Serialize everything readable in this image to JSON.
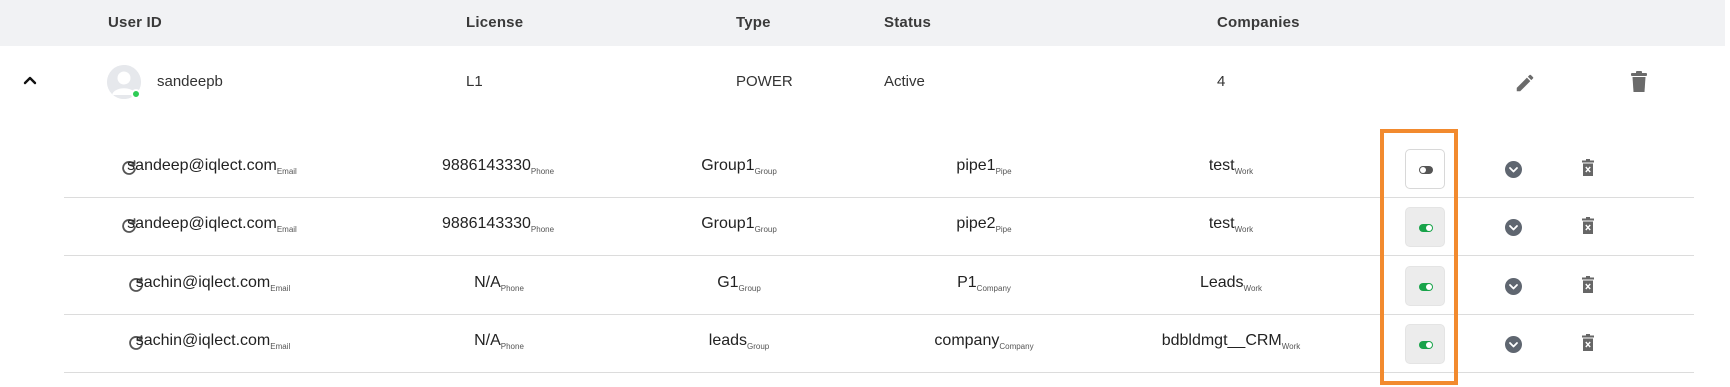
{
  "header": {
    "user_id": "User ID",
    "license": "License",
    "type": "Type",
    "status": "Status",
    "companies": "Companies"
  },
  "user": {
    "username": "sandeepb",
    "license": "L1",
    "type": "POWER",
    "status": "Active",
    "companies": "4",
    "expanded": true,
    "online": true
  },
  "icons": {
    "collapse": "chevron-up-icon",
    "edit": "pencil-icon",
    "delete": "trash-icon",
    "refresh": "refresh-icon",
    "toggle": "toggle-icon",
    "expand": "chevron-down-circle-icon",
    "remove": "trash-x-icon"
  },
  "colors": {
    "header_bg": "#f1f2f4",
    "toggle_on": "#18a34a",
    "online": "#2ecc55",
    "highlight": "#f28a2e"
  },
  "mappings": [
    {
      "email": "sandeep@iqlect.com",
      "email_tag": "Email",
      "phone": "9886143330",
      "phone_tag": "Phone",
      "group": "Group1",
      "group_tag": "Group",
      "target": "pipe1",
      "target_tag": "Pipe",
      "work": "test",
      "work_tag": "Work",
      "enabled": false
    },
    {
      "email": "sandeep@iqlect.com",
      "email_tag": "Email",
      "phone": "9886143330",
      "phone_tag": "Phone",
      "group": "Group1",
      "group_tag": "Group",
      "target": "pipe2",
      "target_tag": "Pipe",
      "work": "test",
      "work_tag": "Work",
      "enabled": true
    },
    {
      "email": "sachin@iqlect.com",
      "email_tag": "Email",
      "phone": "N/A",
      "phone_tag": "Phone",
      "group": "G1",
      "group_tag": "Group",
      "target": "P1",
      "target_tag": "Company",
      "work": "Leads",
      "work_tag": "Work",
      "enabled": true
    },
    {
      "email": "sachin@iqlect.com",
      "email_tag": "Email",
      "phone": "N/A",
      "phone_tag": "Phone",
      "group": "leads",
      "group_tag": "Group",
      "target": "company",
      "target_tag": "Company",
      "work": "bdbldmgt__CRM",
      "work_tag": "Work",
      "enabled": true
    }
  ]
}
